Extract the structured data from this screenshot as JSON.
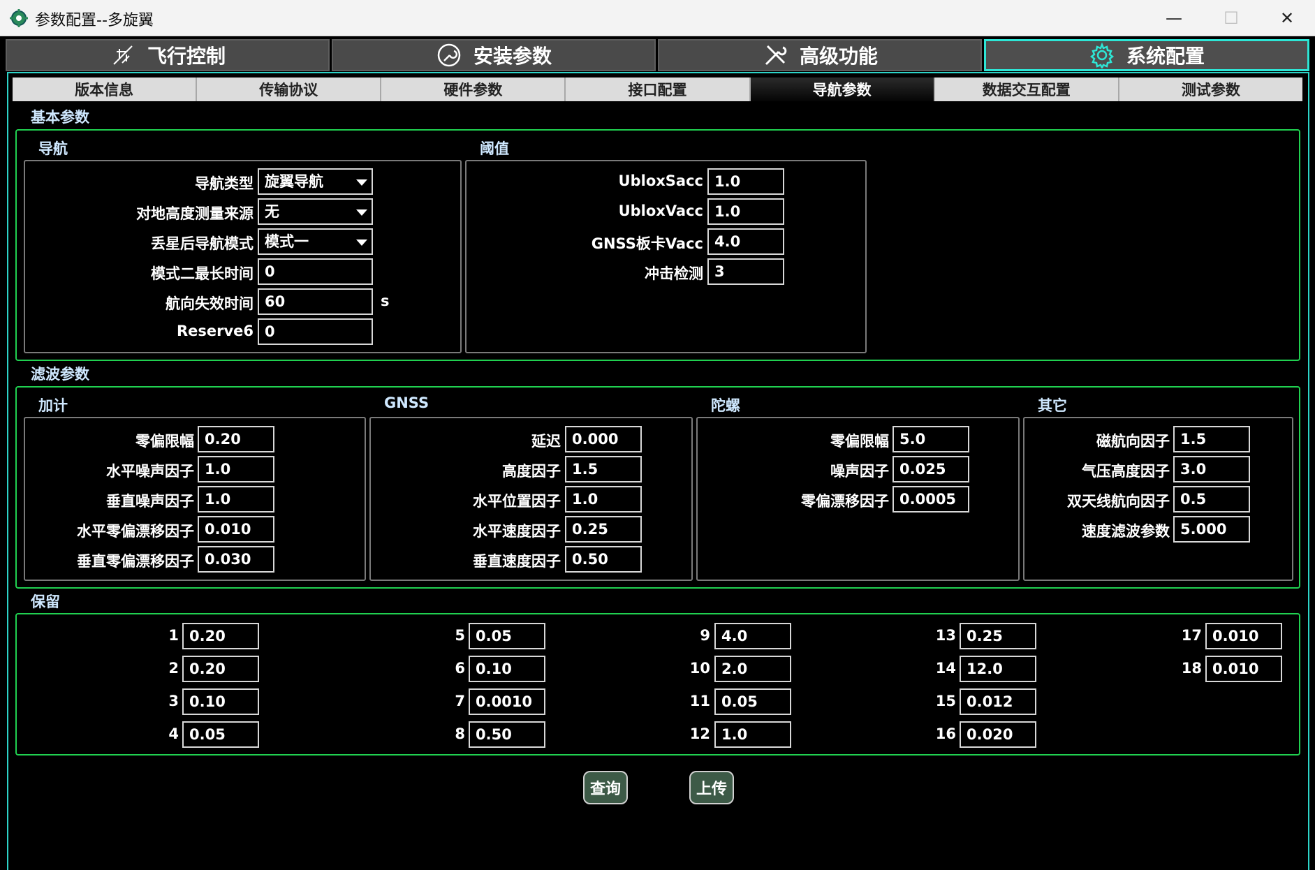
{
  "window": {
    "title": "参数配置--多旋翼",
    "minimize": "—",
    "maximize": "☐",
    "close": "✕"
  },
  "main_tabs": [
    {
      "label": "飞行控制",
      "icon": "airplane-icon"
    },
    {
      "label": "安装参数",
      "icon": "wrench-circle-icon"
    },
    {
      "label": "高级功能",
      "icon": "tools-icon"
    },
    {
      "label": "系统配置",
      "icon": "gear-icon",
      "active": true
    }
  ],
  "sub_tabs": [
    "版本信息",
    "传输协议",
    "硬件参数",
    "接口配置",
    "导航参数",
    "数据交互配置",
    "测试参数"
  ],
  "basic": {
    "title": "基本参数",
    "nav": {
      "title": "导航",
      "nav_type": {
        "label": "导航类型",
        "value": "旋翼导航"
      },
      "ground_height_source": {
        "label": "对地高度测量来源",
        "value": "无"
      },
      "lost_sat_mode": {
        "label": "丢星后导航模式",
        "value": "模式一"
      },
      "mode2_max_time": {
        "label": "模式二最长时间",
        "value": "0"
      },
      "heading_invalid_time": {
        "label": "航向失效时间",
        "value": "60",
        "unit": "s"
      },
      "reserve6": {
        "label": "Reserve6",
        "value": "0"
      }
    },
    "threshold": {
      "title": "阈值",
      "ublox_sacc": {
        "label": "UbloxSacc",
        "value": "1.0"
      },
      "ublox_vacc": {
        "label": "UbloxVacc",
        "value": "1.0"
      },
      "gnss_vacc": {
        "label": "GNSS板卡Vacc",
        "value": "4.0"
      },
      "shock_detect": {
        "label": "冲击检测",
        "value": "3"
      }
    }
  },
  "filter": {
    "title": "滤波参数",
    "accel": {
      "title": "加计",
      "rows": [
        {
          "label": "零偏限幅",
          "value": "0.20"
        },
        {
          "label": "水平噪声因子",
          "value": "1.0"
        },
        {
          "label": "垂直噪声因子",
          "value": "1.0"
        },
        {
          "label": "水平零偏漂移因子",
          "value": "0.010"
        },
        {
          "label": "垂直零偏漂移因子",
          "value": "0.030"
        }
      ]
    },
    "gnss": {
      "title": "GNSS",
      "rows": [
        {
          "label": "延迟",
          "value": "0.000"
        },
        {
          "label": "高度因子",
          "value": "1.5"
        },
        {
          "label": "水平位置因子",
          "value": "1.0"
        },
        {
          "label": "水平速度因子",
          "value": "0.25"
        },
        {
          "label": "垂直速度因子",
          "value": "0.50"
        }
      ]
    },
    "gyro": {
      "title": "陀螺",
      "rows": [
        {
          "label": "零偏限幅",
          "value": "5.0"
        },
        {
          "label": "噪声因子",
          "value": "0.025"
        },
        {
          "label": "零偏漂移因子",
          "value": "0.0005"
        }
      ]
    },
    "other": {
      "title": "其它",
      "rows": [
        {
          "label": "磁航向因子",
          "value": "1.5"
        },
        {
          "label": "气压高度因子",
          "value": "3.0"
        },
        {
          "label": "双天线航向因子",
          "value": "0.5"
        },
        {
          "label": "速度滤波参数",
          "value": "5.000"
        }
      ]
    }
  },
  "reserved": {
    "title": "保留",
    "items": [
      {
        "label": "1",
        "value": "0.20"
      },
      {
        "label": "2",
        "value": "0.20"
      },
      {
        "label": "3",
        "value": "0.10"
      },
      {
        "label": "4",
        "value": "0.05"
      },
      {
        "label": "5",
        "value": "0.05"
      },
      {
        "label": "6",
        "value": "0.10"
      },
      {
        "label": "7",
        "value": "0.0010"
      },
      {
        "label": "8",
        "value": "0.50"
      },
      {
        "label": "9",
        "value": "4.0"
      },
      {
        "label": "10",
        "value": "2.0"
      },
      {
        "label": "11",
        "value": "0.05"
      },
      {
        "label": "12",
        "value": "1.0"
      },
      {
        "label": "13",
        "value": "0.25"
      },
      {
        "label": "14",
        "value": "12.0"
      },
      {
        "label": "15",
        "value": "0.012"
      },
      {
        "label": "16",
        "value": "0.020"
      },
      {
        "label": "17",
        "value": "0.010"
      },
      {
        "label": "18",
        "value": "0.010"
      }
    ]
  },
  "actions": {
    "query": "查询",
    "upload": "上传"
  },
  "colors": {
    "group_border": "#20d050",
    "active_tab_border": "#2ee6d6",
    "button_bg": "#3d5a47"
  }
}
